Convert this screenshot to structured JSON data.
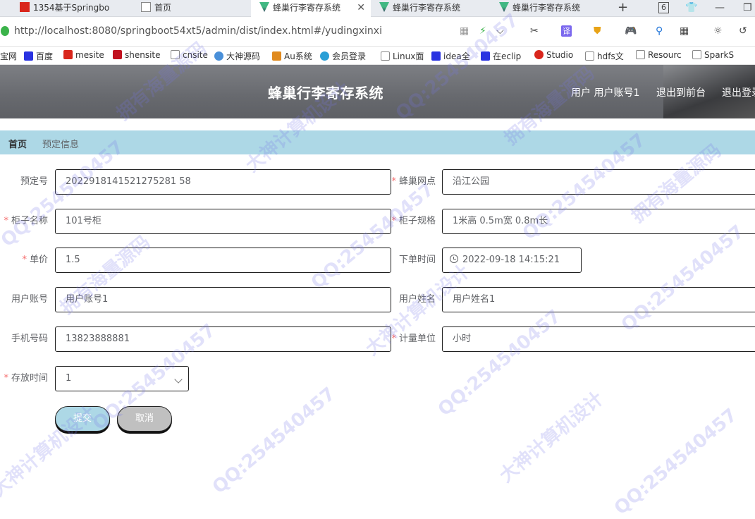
{
  "browser": {
    "tabs": [
      {
        "title": "1354基于Springbo",
        "active": false
      },
      {
        "title": "首页",
        "active": false
      },
      {
        "title": "蜂巢行李寄存系统",
        "active": true
      },
      {
        "title": "蜂巢行李寄存系统",
        "active": false
      },
      {
        "title": "蜂巢行李寄存系统",
        "active": false
      }
    ],
    "close_glyph": "✕",
    "new_tab_glyph": "+",
    "tab_count": "6",
    "minimize_glyph": "—",
    "restore_glyph": "❐",
    "url": "http://localhost:8080/springboot54xt5/admin/dist/index.html#/yudingxinxi",
    "toolbar": {
      "translate": "译",
      "scissors_glyph": "✂",
      "search_glyph": "⚲",
      "grid_glyph": "▦",
      "sun_glyph": "☼",
      "undo_glyph": "↺",
      "chevron_glyph": "⌵"
    },
    "bookmarks": [
      "宝网",
      "百度",
      "mesite",
      "shensite",
      "cnsite",
      "大神源码",
      "Au系统",
      "会员登录",
      "Linux面",
      "idea全",
      "在eclip",
      "Studio",
      "hdfs文",
      "Resourc",
      "SparkS"
    ]
  },
  "header": {
    "title": "蜂巢行李寄存系统",
    "user_label": "用户 用户账号1",
    "front_link": "退出到前台",
    "logout_link": "退出登录"
  },
  "breadcrumb": {
    "home": "首页",
    "current": "预定信息"
  },
  "form": {
    "booking_no": {
      "label": "预定号",
      "value": "2022918141521275281 58"
    },
    "outlet": {
      "label": "蜂巢网点",
      "value": "沿江公园"
    },
    "locker_name": {
      "label": "柜子名称",
      "value": "101号柜"
    },
    "locker_spec": {
      "label": "柜子规格",
      "value": "1米高 0.5m宽 0.8m长"
    },
    "unit_price": {
      "label": "单价",
      "value": "1.5"
    },
    "order_time": {
      "label": "下单时间",
      "value": "2022-09-18 14:15:21"
    },
    "user_account": {
      "label": "用户账号",
      "value": "用户账号1"
    },
    "user_name": {
      "label": "用户姓名",
      "value": "用户姓名1"
    },
    "phone": {
      "label": "手机号码",
      "value": "13823888881"
    },
    "unit": {
      "label": "计量单位",
      "value": "小时"
    },
    "storage_time": {
      "label": "存放时间",
      "value": "1"
    },
    "required_mark": "*"
  },
  "buttons": {
    "submit": "提交",
    "cancel": "取消"
  },
  "watermarks": [
    "QQ:254540457",
    "拥有海量源码",
    "大神计算机设计"
  ],
  "colors": {
    "header_bg": "#6e7075",
    "breadcrumb_bg": "#add8e6",
    "submit_bg": "#add8e6",
    "cancel_bg": "#c0c0c0",
    "required": "#f56c6c"
  }
}
